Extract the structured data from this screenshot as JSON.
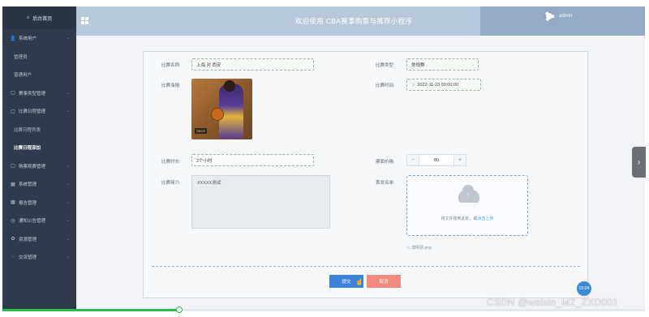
{
  "sidebar": {
    "home": "后台首页",
    "items": [
      {
        "icon": "user-icon",
        "label": "系统用户",
        "expanded": true
      },
      {
        "sub": true,
        "label": "管理员"
      },
      {
        "sub": true,
        "label": "普通用户"
      },
      {
        "icon": "document-icon",
        "label": "赛事类型管理"
      },
      {
        "icon": "document-icon",
        "label": "比赛日程管理",
        "expanded": true
      },
      {
        "sub": true,
        "label": "比赛日程列表"
      },
      {
        "sub": true,
        "label": "比赛日程添加",
        "active": true
      },
      {
        "icon": "document-icon",
        "label": "购票观赛管理"
      },
      {
        "icon": "grid-icon",
        "label": "系统管理"
      },
      {
        "icon": "grid-icon",
        "label": "报告管理"
      },
      {
        "icon": "clock-icon",
        "label": "通知公告管理"
      },
      {
        "icon": "gear-icon",
        "label": "资源管理"
      },
      {
        "icon": "chat-icon",
        "label": "交流管理"
      }
    ]
  },
  "header": {
    "title": "欢迎使用 CBA赛事购票与推荐小程序",
    "username": "admin"
  },
  "form": {
    "match_name_label": "比赛名称:",
    "match_name_value": "上海 对 西安",
    "match_type_label": "比赛类型:",
    "match_type_value": "常规赛",
    "poster_label": "比赛海报:",
    "poster_tag": "SBOP",
    "match_time_label": "比赛时间:",
    "match_time_value": "2022-11-23 00:00:00",
    "duration_label": "比赛时长:",
    "duration_value": "2个小时",
    "price_label": "票面价格:",
    "price_value": "80",
    "minus": "−",
    "plus": "+",
    "intro_label": "比赛简介:",
    "intro_value": "XXXXX测试",
    "ticket_label": "首发名单:",
    "upload_text_prefix": "将文件拖到此处，或",
    "upload_text_link": "点击上传",
    "file_name": "澳明票.png",
    "submit": "提交",
    "reset": "取消"
  },
  "misc": {
    "side_tab_arrow": "›",
    "time_bubble": "02:04",
    "watermark": "CSDN @weixin_MZ_ZXD001",
    "progress_fraction": 0.275
  },
  "colors": {
    "sidebar_bg": "#2f3a4b",
    "header_bg": "#b8c8dc",
    "primary": "#3b82d9",
    "danger": "#f08a7b"
  }
}
